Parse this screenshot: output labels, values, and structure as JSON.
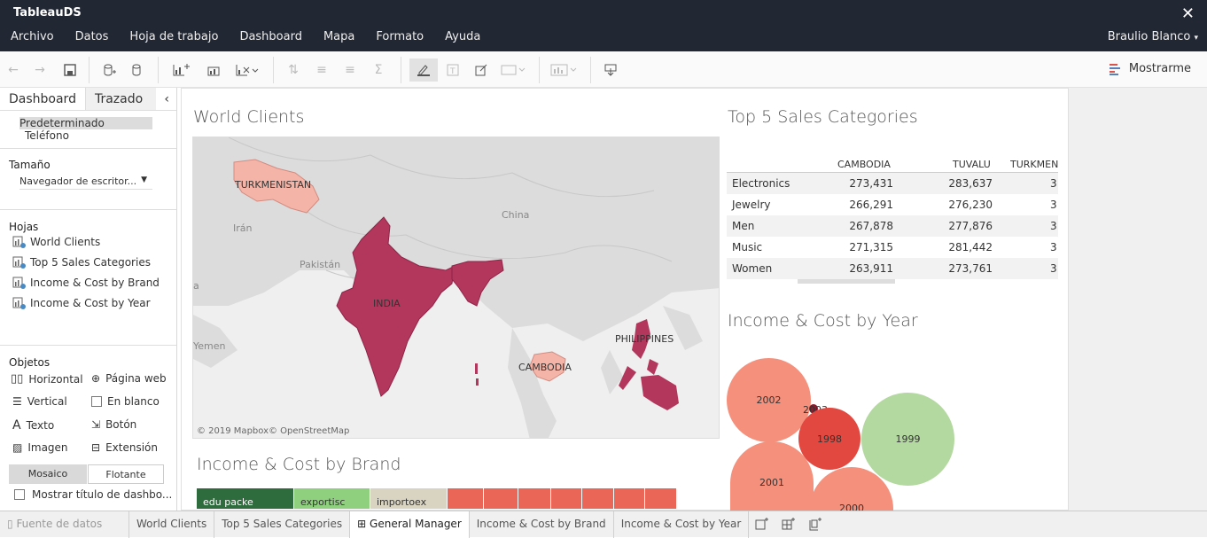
{
  "app": {
    "title": "TableauDS",
    "close": "✕"
  },
  "menu": [
    "Archivo",
    "Datos",
    "Hoja de trabajo",
    "Dashboard",
    "Mapa",
    "Formato",
    "Ayuda"
  ],
  "user": "Braulio Blanco",
  "toolbar": {
    "show_me": "Mostrarme"
  },
  "sidebar": {
    "tabs": [
      "Dashboard",
      "Trazado"
    ],
    "devices": [
      "Predeterminado",
      "Teléfono"
    ],
    "size_title": "Tamaño",
    "size_value": "Navegador de escritor...",
    "sheets_title": "Hojas",
    "sheets": [
      "World Clients",
      "Top 5 Sales Categories",
      "Income & Cost by Brand",
      "Income & Cost by Year"
    ],
    "objects_title": "Objetos",
    "objects": [
      "Horizontal",
      "Página web",
      "Vertical",
      "En blanco",
      "Texto",
      "Botón",
      "Imagen",
      "Extensión"
    ],
    "mode": [
      "Mosaico",
      "Flotante"
    ],
    "show_title": "Mostrar título de dashbo..."
  },
  "map": {
    "title": "World Clients",
    "labels": {
      "turkmenistan": "TURKMENISTAN",
      "iran": "Irán",
      "pakistan": "Pakistán",
      "china": "China",
      "india": "INDIA",
      "cambodia": "CAMBODIA",
      "philippines": "PHILIPPINES",
      "yemen": "Yemen",
      "a": "a"
    },
    "attribution": "© 2019 Mapbox© OpenStreetMap",
    "colors": {
      "high": "#b3375c",
      "low": "#f4b5a8",
      "land": "#d9d9d9"
    }
  },
  "top5": {
    "title": "Top 5 Sales Categories",
    "columns": [
      "CAMBODIA",
      "TUVALU",
      "TURKMEN"
    ],
    "rows": [
      {
        "cat": "Electronics",
        "cambodia": "273,431",
        "tuvalu": "283,637",
        "turkmen": "3"
      },
      {
        "cat": "Jewelry",
        "cambodia": "266,291",
        "tuvalu": "276,230",
        "turkmen": "3"
      },
      {
        "cat": "Men",
        "cambodia": "267,878",
        "tuvalu": "277,876",
        "turkmen": "3"
      },
      {
        "cat": "Music",
        "cambodia": "271,315",
        "tuvalu": "281,442",
        "turkmen": "3"
      },
      {
        "cat": "Women",
        "cambodia": "263,911",
        "tuvalu": "273,761",
        "turkmen": "3"
      }
    ]
  },
  "year": {
    "title": "Income & Cost by Year",
    "bubbles": [
      "2002",
      "2003",
      "1998",
      "1999",
      "2001",
      "2000"
    ]
  },
  "brand": {
    "title": "Income & Cost by Brand",
    "cells": [
      "edu packe",
      "exportisc",
      "importoex"
    ]
  },
  "bottom_tabs": [
    "Fuente de datos",
    "World Clients",
    "Top 5 Sales Categories",
    "General Manager",
    "Income & Cost by Brand",
    "Income & Cost by Year"
  ]
}
